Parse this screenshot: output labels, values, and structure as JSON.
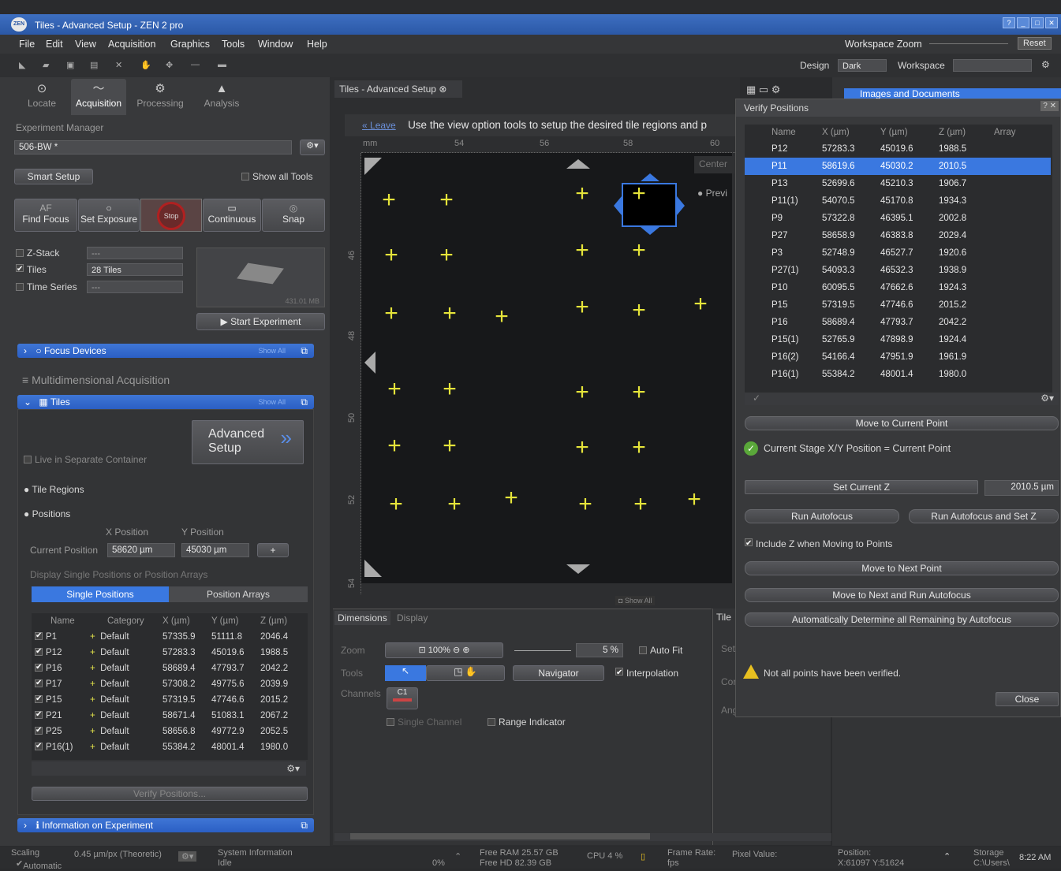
{
  "window": {
    "title": "Tiles - Advanced Setup - ZEN 2 pro",
    "logo": "ZEN",
    "buttons": [
      "?",
      "_",
      "□",
      "✕"
    ]
  },
  "menu": [
    "File",
    "Edit",
    "View",
    "Acquisition",
    "Graphics",
    "Tools",
    "Window",
    "Help"
  ],
  "workspace": {
    "zoom_label": "Workspace Zoom",
    "reset": "Reset",
    "design_label": "Design",
    "design_value": "Dark",
    "workspace_label": "Workspace"
  },
  "left_tabs": [
    {
      "label": "Locate",
      "icon": "⊙"
    },
    {
      "label": "Acquisition",
      "icon": "〜"
    },
    {
      "label": "Processing",
      "icon": "⚙"
    },
    {
      "label": "Analysis",
      "icon": "▲"
    }
  ],
  "experiment": {
    "label": "Experiment Manager",
    "value": "506-BW *",
    "smart_setup": "Smart Setup",
    "show_all_tools": "Show all Tools"
  },
  "acq_buttons": [
    {
      "label": "Find Focus",
      "top": "AF"
    },
    {
      "label": "Set Exposure",
      "top": "○"
    },
    {
      "label": "",
      "top": "Stop"
    },
    {
      "label": "Continuous",
      "top": "▭"
    },
    {
      "label": "Snap",
      "top": "◎"
    }
  ],
  "dims": [
    {
      "label": "Z-Stack",
      "value": "---",
      "checked": false
    },
    {
      "label": "Tiles",
      "value": "28 Tiles",
      "checked": true
    },
    {
      "label": "Time Series",
      "value": "---",
      "checked": false
    }
  ],
  "size_label": "431.01 MB",
  "start_experiment": "Start Experiment",
  "focus_devices": "Focus Devices",
  "show_all": "Show All",
  "multidim": "Multidimensional Acquisition",
  "tiles_section": {
    "title": "Tiles",
    "advanced": "Advanced",
    "setup": "Setup",
    "live": "Live in Separate Container",
    "tile_regions": "Tile Regions",
    "positions": "Positions",
    "x_label": "X Position",
    "y_label": "Y Position",
    "current_label": "Current Position",
    "x_val": "58620 µm",
    "y_val": "45030 µm",
    "display_label": "Display Single Positions or Position Arrays",
    "tab_single": "Single Positions",
    "tab_arrays": "Position Arrays"
  },
  "pos_table": {
    "headers": [
      "Name",
      "Category",
      "X (µm)",
      "Y (µm)",
      "Z (µm)"
    ],
    "rows": [
      [
        "P1",
        "Default",
        "57335.9",
        "51111.8",
        "2046.4"
      ],
      [
        "P12",
        "Default",
        "57283.3",
        "45019.6",
        "1988.5"
      ],
      [
        "P16",
        "Default",
        "58689.4",
        "47793.7",
        "2042.2"
      ],
      [
        "P17",
        "Default",
        "57308.2",
        "49775.6",
        "2039.9"
      ],
      [
        "P15",
        "Default",
        "57319.5",
        "47746.6",
        "2015.2"
      ],
      [
        "P21",
        "Default",
        "58671.4",
        "51083.1",
        "2067.2"
      ],
      [
        "P25",
        "Default",
        "58656.8",
        "49772.9",
        "2052.5"
      ],
      [
        "P16(1)",
        "Default",
        "55384.2",
        "48001.4",
        "1980.0"
      ]
    ]
  },
  "verify_btn": "Verify Positions...",
  "info_exp": "Information on Experiment",
  "doc_tab": "Tiles - Advanced Setup",
  "banner": {
    "leave": "Leave",
    "text": "Use the view option tools to setup the desired tile regions and p"
  },
  "ruler_top": [
    "mm",
    "54",
    "56",
    "58",
    "60"
  ],
  "ruler_left": [
    "46",
    "48",
    "50",
    "52",
    "54"
  ],
  "center_label": "Center",
  "preview_label": "Previ",
  "dimensions_tab": "Dimensions",
  "display_tab": "Display",
  "zoom": {
    "label": "Zoom",
    "value": "5 %",
    "autofit": "Auto Fit",
    "fit": "100%"
  },
  "tools": {
    "label": "Tools",
    "navigator": "Navigator",
    "interpolation": "Interpolation"
  },
  "channels": {
    "label": "Channels",
    "c1": "C1",
    "single": "Single Channel",
    "range": "Range Indicator"
  },
  "tile_side": {
    "title": "Tile",
    "set": "Set",
    "cor": "Cor",
    "ang": "Ang"
  },
  "verify": {
    "title": "Verify Positions",
    "headers": [
      "Name",
      "X (µm)",
      "Y (µm)",
      "Z (µm)",
      "Array"
    ],
    "rows": [
      [
        "P12",
        "57283.3",
        "45019.6",
        "1988.5"
      ],
      [
        "P11",
        "58619.6",
        "45030.2",
        "2010.5"
      ],
      [
        "P13",
        "52699.6",
        "45210.3",
        "1906.7"
      ],
      [
        "P11(1)",
        "54070.5",
        "45170.8",
        "1934.3"
      ],
      [
        "P9",
        "57322.8",
        "46395.1",
        "2002.8"
      ],
      [
        "P27",
        "58658.9",
        "46383.8",
        "2029.4"
      ],
      [
        "P3",
        "52748.9",
        "46527.7",
        "1920.6"
      ],
      [
        "P27(1)",
        "54093.3",
        "46532.3",
        "1938.9"
      ],
      [
        "P10",
        "60095.5",
        "47662.6",
        "1924.3"
      ],
      [
        "P15",
        "57319.5",
        "47746.6",
        "2015.2"
      ],
      [
        "P16",
        "58689.4",
        "47793.7",
        "2042.2"
      ],
      [
        "P15(1)",
        "52765.9",
        "47898.9",
        "1924.4"
      ],
      [
        "P16(2)",
        "54166.4",
        "47951.9",
        "1961.9"
      ],
      [
        "P16(1)",
        "55384.2",
        "48001.4",
        "1980.0"
      ]
    ],
    "selected": 1,
    "move_current": "Move to Current Point",
    "stage_status": "Current Stage X/Y Position  =  Current Point",
    "set_z": "Set Current Z",
    "z_value": "2010.5 µm",
    "run_af": "Run Autofocus",
    "run_af_z": "Run Autofocus and Set Z",
    "include_z": "Include Z when Moving to Points",
    "move_next": "Move to Next Point",
    "move_next_af": "Move to Next and Run Autofocus",
    "auto_all": "Automatically Determine all Remaining by Autofocus",
    "warning": "Not all points have been verified.",
    "close": "Close"
  },
  "images_docs": "Images and Documents",
  "status": {
    "scaling": "Scaling",
    "scaling_val": "0.45 µm/px (Theoretic)",
    "automatic": "Automatic",
    "sysinfo": "System Information",
    "idle": "Idle",
    "pct": "0%",
    "ram": "Free RAM 25.57 GB",
    "hd": "Free HD 82.39 GB",
    "cpu": "CPU 4 %",
    "frame": "Frame Rate:",
    "fps": "fps",
    "pixel": "Pixel Value:",
    "position": "Position:",
    "pos_val": "X:61097 Y:51624",
    "storage": "Storage",
    "storage_path": "C:\\Users\\",
    "time": "8:22 AM"
  }
}
